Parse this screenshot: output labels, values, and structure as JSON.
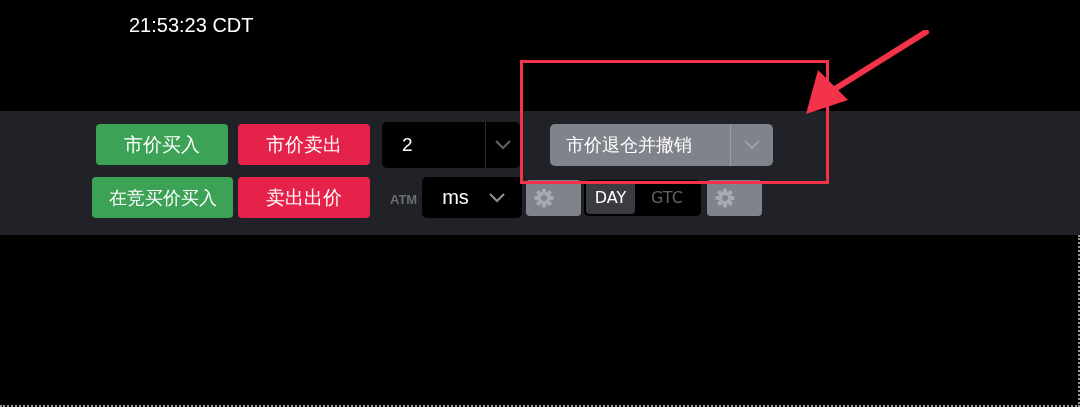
{
  "clock": "21:53:23 CDT",
  "order_buttons": [
    {
      "label": "市价买入",
      "kind": "buy"
    },
    {
      "label": "市价卖出",
      "kind": "sell"
    },
    {
      "label": "在竞买价买入",
      "kind": "buy"
    },
    {
      "label": "卖出出价",
      "kind": "sell"
    }
  ],
  "quantity": {
    "value": "2"
  },
  "close_button": {
    "label": "市价退仓并撤销"
  },
  "atm_label": "ATM",
  "unit_dropdown": {
    "value": "ms"
  },
  "time_in_force": [
    {
      "label": "DAY",
      "selected": true
    },
    {
      "label": "GTC",
      "selected": false
    }
  ]
}
